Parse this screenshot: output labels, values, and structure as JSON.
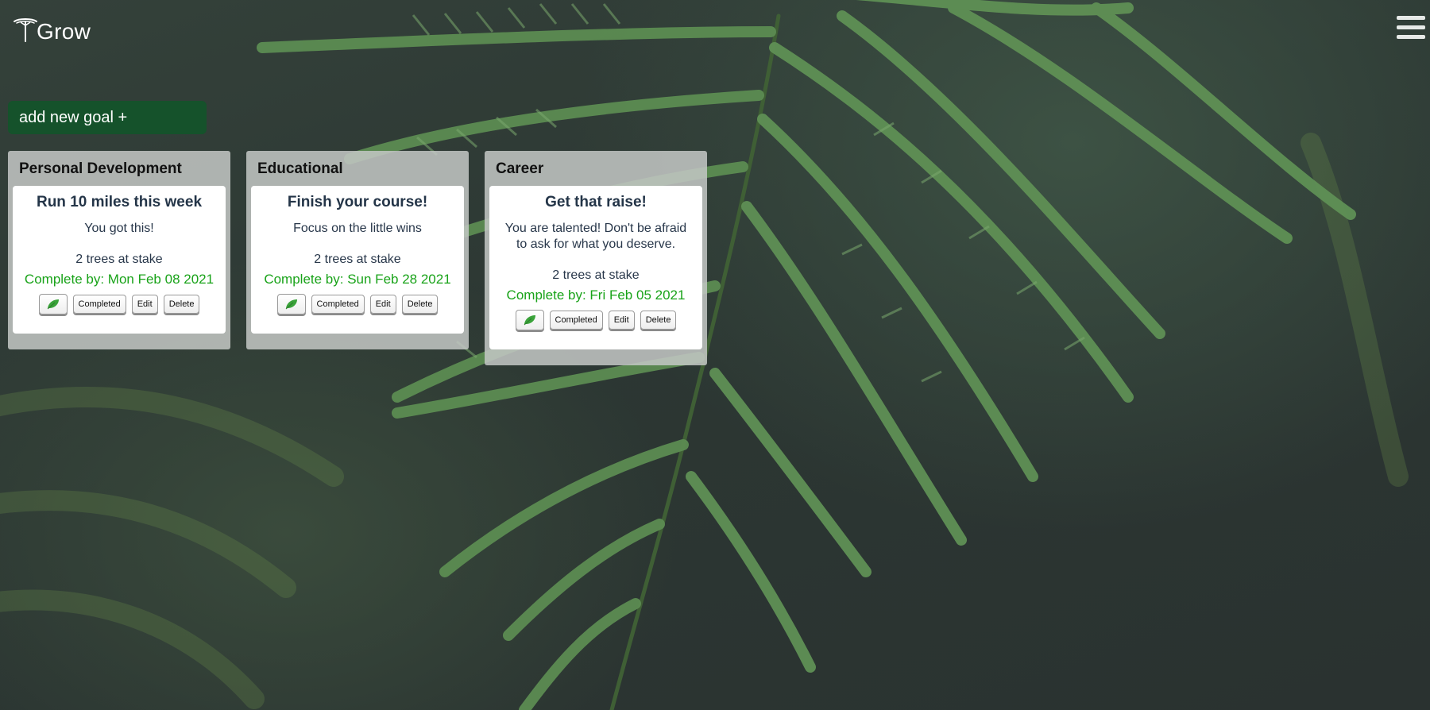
{
  "header": {
    "app_name": "Grow",
    "add_goal_label": "add new goal +"
  },
  "columns": [
    {
      "title": "Personal Development",
      "cards": [
        {
          "title": "Run 10 miles this week",
          "message": "You got this!",
          "stake": "2 trees at stake",
          "due": "Complete by: Mon Feb 08 2021",
          "completed_label": "Completed",
          "edit_label": "Edit",
          "delete_label": "Delete"
        }
      ]
    },
    {
      "title": "Educational",
      "cards": [
        {
          "title": "Finish your course!",
          "message": "Focus on the little wins",
          "stake": "2 trees at stake",
          "due": "Complete by: Sun Feb 28 2021",
          "completed_label": "Completed",
          "edit_label": "Edit",
          "delete_label": "Delete"
        }
      ]
    },
    {
      "title": "Career",
      "cards": [
        {
          "title": "Get that raise!",
          "message": "You are talented! Don't be afraid to ask for what you deserve.",
          "stake": "2 trees at stake",
          "due": "Complete by: Fri Feb 05 2021",
          "completed_label": "Completed",
          "edit_label": "Edit",
          "delete_label": "Delete"
        }
      ]
    }
  ],
  "icons": {
    "logo": "tree-icon",
    "menu": "hamburger-menu-icon",
    "water": "leaf-icon"
  },
  "colors": {
    "accent": "#15522b",
    "due_date": "#19a319",
    "leaf": "#3aa33a"
  }
}
